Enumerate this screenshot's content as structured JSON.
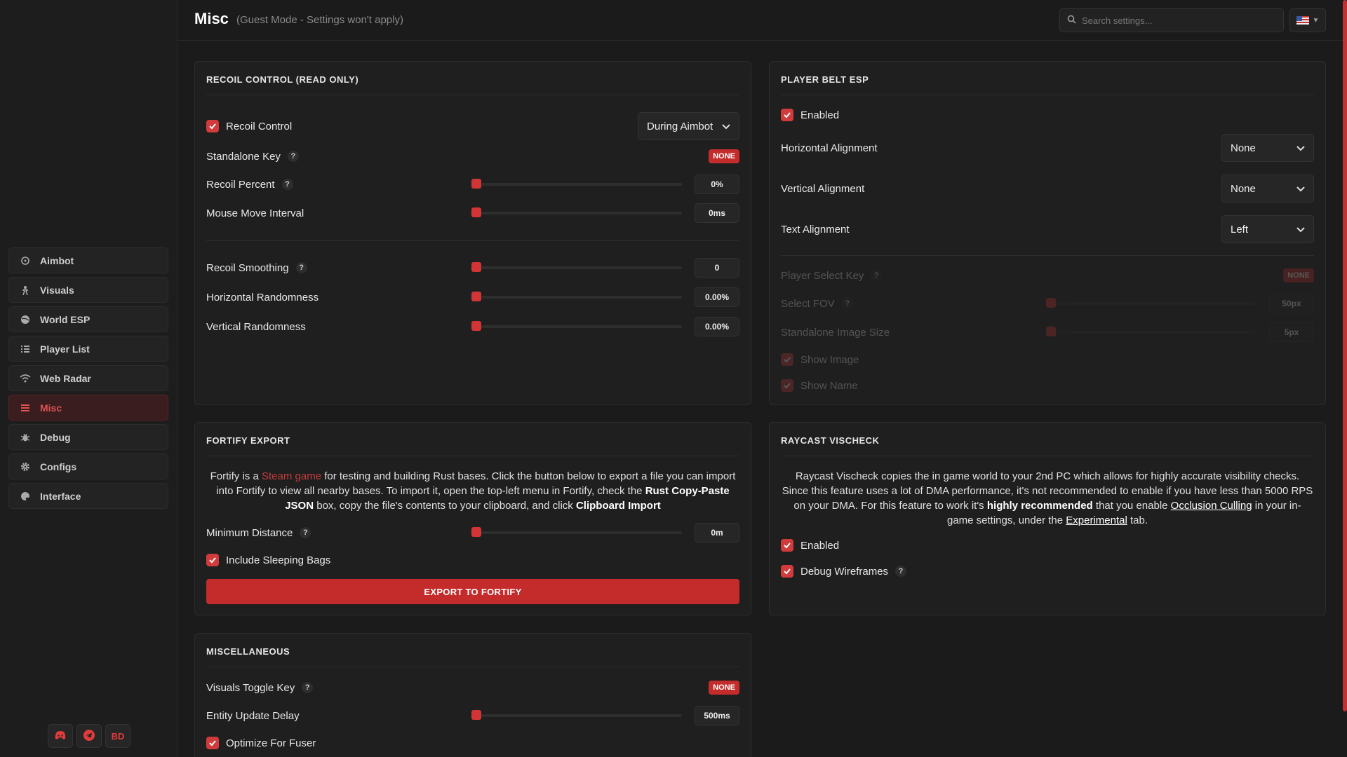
{
  "sidebar": {
    "items": [
      {
        "label": "Aimbot",
        "icon": "crosshair-icon"
      },
      {
        "label": "Visuals",
        "icon": "person-icon"
      },
      {
        "label": "World ESP",
        "icon": "globe-icon"
      },
      {
        "label": "Player List",
        "icon": "list-icon"
      },
      {
        "label": "Web Radar",
        "icon": "wifi-icon"
      },
      {
        "label": "Misc",
        "icon": "menu-icon",
        "active": true
      },
      {
        "label": "Debug",
        "icon": "bug-icon"
      },
      {
        "label": "Configs",
        "icon": "gear-icon"
      },
      {
        "label": "Interface",
        "icon": "palette-icon"
      }
    ],
    "social": [
      {
        "icon": "discord-icon",
        "label": ""
      },
      {
        "icon": "telegram-icon",
        "label": ""
      },
      {
        "icon": "bd-icon",
        "label": "BD"
      }
    ]
  },
  "header": {
    "title": "Misc",
    "subtitle": "(Guest Mode - Settings won't apply)",
    "search_placeholder": "Search settings...",
    "language": "en-US"
  },
  "recoil": {
    "title": "RECOIL CONTROL (READ ONLY)",
    "recoil_control_label": "Recoil Control",
    "recoil_control_checked": true,
    "mode": "During Aimbot",
    "standalone_key_label": "Standalone Key",
    "standalone_key_value": "NONE",
    "recoil_percent_label": "Recoil Percent",
    "recoil_percent_value": "0%",
    "mouse_move_label": "Mouse Move Interval",
    "mouse_move_value": "0ms",
    "recoil_smoothing_label": "Recoil Smoothing",
    "recoil_smoothing_value": "0",
    "h_random_label": "Horizontal Randomness",
    "h_random_value": "0.00%",
    "v_random_label": "Vertical Randomness",
    "v_random_value": "0.00%"
  },
  "belt": {
    "title": "PLAYER BELT ESP",
    "enabled_label": "Enabled",
    "halign_label": "Horizontal Alignment",
    "halign_value": "None",
    "valign_label": "Vertical Alignment",
    "valign_value": "None",
    "talign_label": "Text Alignment",
    "talign_value": "Left",
    "player_select_key_label": "Player Select Key",
    "player_select_key_value": "NONE",
    "select_fov_label": "Select FOV",
    "select_fov_value": "50px",
    "image_size_label": "Standalone Image Size",
    "image_size_value": "5px",
    "show_image_label": "Show Image",
    "show_name_label": "Show Name"
  },
  "fortify": {
    "title": "FORTIFY EXPORT",
    "desc_1": "Fortify is a",
    "desc_link": "Steam game",
    "desc_2": "for testing and building Rust bases. Click the button below to export a file you can import into Fortify to view all nearby bases. To import it, open the top-left menu in Fortify, check the",
    "desc_bold_1": "Rust Copy-Paste JSON",
    "desc_3": "box, copy the file's contents to your clipboard, and click",
    "desc_bold_2": "Clipboard Import",
    "min_distance_label": "Minimum Distance",
    "min_distance_value": "0m",
    "sleeping_bags_label": "Include Sleeping Bags",
    "export_label": "EXPORT TO FORTIFY"
  },
  "raycast": {
    "title": "RAYCAST VISCHECK",
    "desc_1": "Raycast Vischeck copies the in game world to your 2nd PC which allows for highly accurate visibility checks. Since this feature uses a lot of DMA performance, it's not recommended to enable if you have less than 5000 RPS on your DMA. For this feature to work it's",
    "desc_bold": "highly recommended",
    "desc_2": "that you enable",
    "desc_link_1": "Occlusion Culling",
    "desc_3": "in your in-game settings, under the",
    "desc_link_2": "Experimental",
    "desc_4": "tab.",
    "enabled_label": "Enabled",
    "wireframes_label": "Debug Wireframes"
  },
  "misc": {
    "title": "MISCELLANEOUS",
    "visuals_toggle_label": "Visuals Toggle Key",
    "visuals_toggle_value": "NONE",
    "entity_delay_label": "Entity Update Delay",
    "entity_delay_value": "500ms",
    "optimize_label": "Optimize For Fuser"
  },
  "colors": {
    "accent": "#c42c2c",
    "background": "#1b1b1b",
    "panel": "#1f1f1f"
  }
}
